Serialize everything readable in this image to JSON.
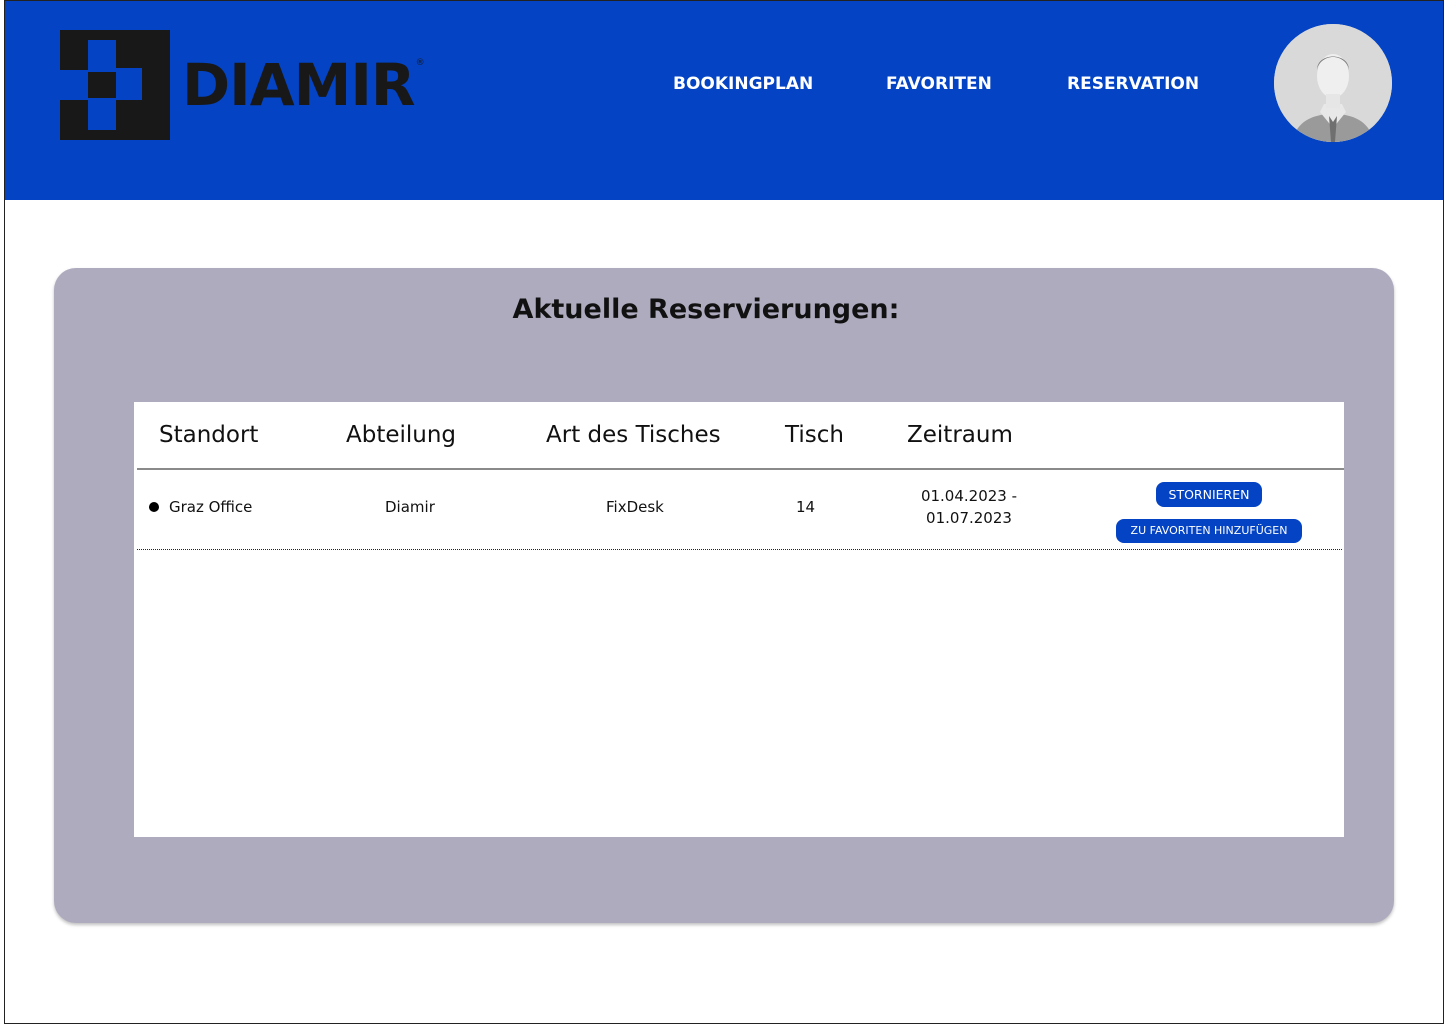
{
  "brand": {
    "name": "DIAMIR",
    "registered_mark": "®",
    "colors": {
      "primary": "#0443c3",
      "logo_dark": "#181818",
      "panel": "#aeabbe"
    }
  },
  "nav": {
    "items": [
      {
        "label": "BOOKINGPLAN"
      },
      {
        "label": "FAVORITEN"
      },
      {
        "label": "RESERVATION"
      }
    ]
  },
  "user": {
    "avatar_icon": "user-avatar"
  },
  "reservations": {
    "title": "Aktuelle Reservierungen:",
    "columns": [
      "Standort",
      "Abteilung",
      "Art des Tisches",
      "Tisch",
      "Zeitraum"
    ],
    "rows": [
      {
        "standort": "Graz Office",
        "abteilung": "Diamir",
        "art": "FixDesk",
        "tisch": "14",
        "zeitraum_start": "01.04.2023 -",
        "zeitraum_end": "01.07.2023",
        "actions": {
          "cancel": "STORNIEREN",
          "favorite": "ZU FAVORITEN HINZUFÜGEN"
        }
      }
    ]
  }
}
